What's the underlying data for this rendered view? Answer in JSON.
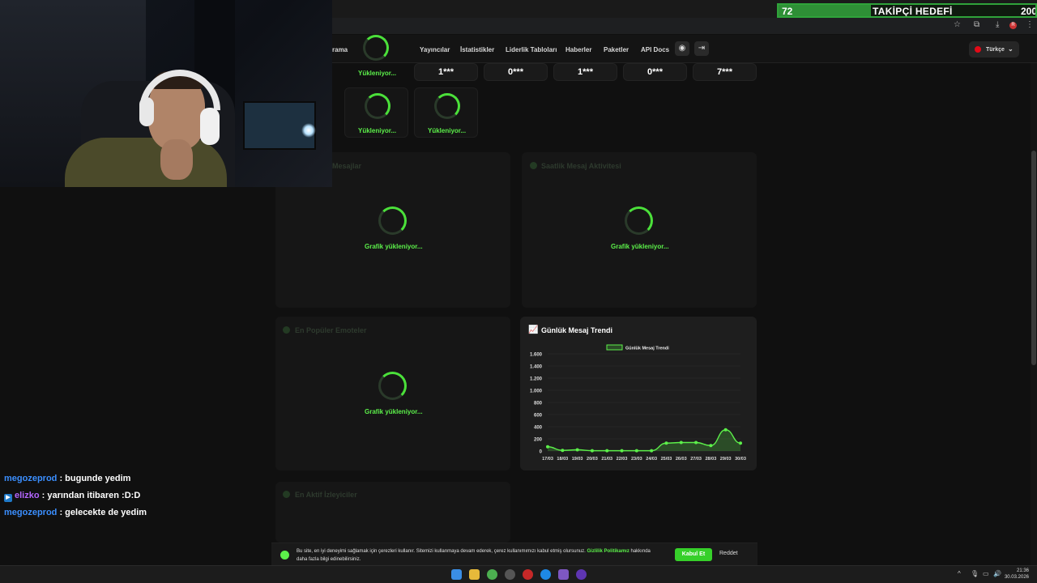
{
  "overlay": {
    "goal_current": "72",
    "goal_title": "TAKİPÇİ HEDEFİ",
    "goal_target": "200",
    "goal_progress": 0.36
  },
  "nav": {
    "items": [
      "rama",
      "Yayıncılar",
      "İstatistikler",
      "Liderlik Tabloları",
      "Haberler",
      "Paketler",
      "API Docs"
    ],
    "language": "Türkçe"
  },
  "stats": {
    "values": [
      "1***",
      "0***",
      "1***",
      "0***",
      "7***"
    ],
    "loading_label": "Yükleniyor..."
  },
  "panels": {
    "chart_loading": "Grafik yükleniyor...",
    "dim_titles": [
      "Mesajlar",
      "Saatlik Mesaj Aktivitesi",
      "En Popüler Emoteler",
      "En Aktif İzleyiciler"
    ]
  },
  "chart": {
    "title": "Günlük Mesaj Trendi"
  },
  "chart_data": {
    "type": "area",
    "title": "Günlük Mesaj Trendi",
    "x": [
      "17/03",
      "18/03",
      "19/03",
      "20/03",
      "21/03",
      "22/03",
      "23/03",
      "24/03",
      "25/03",
      "26/03",
      "27/03",
      "28/03",
      "29/03",
      "30/03"
    ],
    "series": [
      {
        "name": "Günlük Mesaj Trendi",
        "values": [
          70,
          10,
          20,
          5,
          5,
          5,
          5,
          5,
          130,
          140,
          140,
          90,
          350,
          130
        ]
      }
    ],
    "yticks": [
      "1.600",
      "1.400",
      "1.200",
      "1.000",
      "800",
      "600",
      "400",
      "200",
      "0"
    ],
    "ylim": [
      0,
      1600
    ],
    "grid": true,
    "legend": "top-center",
    "color": "#5cf04a"
  },
  "chat": [
    {
      "user": "megozeprod",
      "message": " : bugunde yedim",
      "color": "#3b8fff",
      "badge": false
    },
    {
      "user": "elizko",
      "message": " : yarından itibaren :D:D",
      "color": "#b466ff",
      "badge": true
    },
    {
      "user": "megozeprod",
      "message": " : gelecekte de yedim",
      "color": "#3b8fff",
      "badge": false
    }
  ],
  "cookie": {
    "text": "Bu site, en iyi deneyimi sağlamak için çerezleri kullanır. Sitemizi kullanmaya devam ederek, çerez kullanımımızı kabul etmiş olursunuz. ",
    "link": "Gizlilik Politikamız",
    "text_after": " hakkında daha fazla bilgi edinebilirsiniz.",
    "accept": "Kabul Et",
    "reject": "Reddet"
  },
  "taskbar": {
    "time": "21:36",
    "date": "30.03.2026"
  },
  "icons": {
    "discord": "discord-icon",
    "login": "login-icon",
    "chart": "trend-chart-icon",
    "cookie": "cookie-icon"
  }
}
